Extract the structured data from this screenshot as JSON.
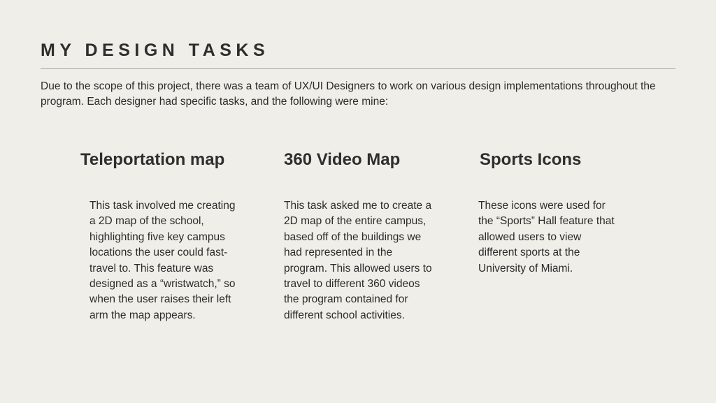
{
  "slide": {
    "title": "MY DESIGN TASKS",
    "intro": "Due to the scope of this project, there was a team of UX/UI Designers to work on various design implementations throughout the program. Each designer had specific tasks, and the following were mine:"
  },
  "tasks": [
    {
      "heading": "Teleportation map",
      "description": "This task involved me creating a 2D map of the school, highlighting five key campus locations the user could fast-travel to. This feature was designed as a “wristwatch,” so when the user raises their left arm the map appears."
    },
    {
      "heading": "360 Video Map",
      "description": "This task asked me to create a 2D map of the entire campus, based off of the buildings we had represented in the program. This allowed users to travel to different 360 videos the program contained for different school activities."
    },
    {
      "heading": "Sports Icons",
      "description": "These icons were used for the “Sports” Hall feature that allowed users to view different sports at the University of Miami."
    }
  ]
}
